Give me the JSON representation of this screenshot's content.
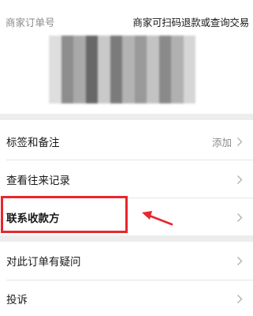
{
  "order": {
    "label": "商家订单号",
    "value": "商家可扫码退款或查询交易"
  },
  "menu": {
    "items": [
      {
        "label": "标签和备注",
        "action": "添加"
      },
      {
        "label": "查看往来记录"
      },
      {
        "label": "联系收款方"
      },
      {
        "label": "对此订单有疑问"
      },
      {
        "label": "投诉"
      }
    ]
  },
  "colors": {
    "annotation_red": "#e8262b",
    "page_background": "#ededed"
  },
  "icons": {
    "chevron": "chevron-right-icon",
    "arrow": "red-arrow-icon"
  }
}
